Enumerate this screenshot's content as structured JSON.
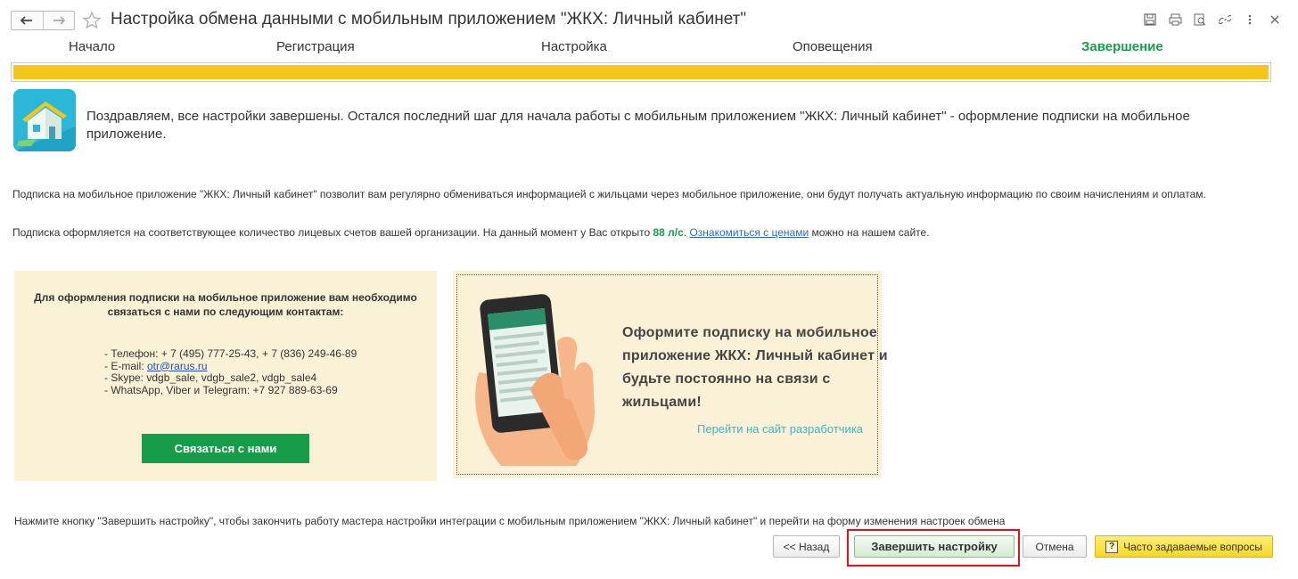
{
  "window": {
    "title": "Настройка обмена данными с мобильным приложением \"ЖКХ: Личный кабинет\""
  },
  "steps": [
    {
      "label": "Начало",
      "active": false
    },
    {
      "label": "Регистрация",
      "active": false
    },
    {
      "label": "Настройка",
      "active": false
    },
    {
      "label": "Оповещения",
      "active": false
    },
    {
      "label": "Завершение",
      "active": true
    }
  ],
  "progress": {
    "value": 1.0,
    "color": "#f5c518"
  },
  "intro": "Поздравляем, все настройки завершены. Остался последний шаг для начала работы с мобильным приложением \"ЖКХ: Личный кабинет\" - оформление подписки на мобильное приложение.",
  "paragraph1": "Подписка на мобильное приложение \"ЖКХ: Личный кабинет\" позволит вам регулярно обмениваться информацией с жильцами через мобильное приложение, они будут получать актуальную информацию по своим начислениям и оплатам.",
  "paragraph2": {
    "before": "Подписка оформляется на соответствующее количество лицевых счетов вашей организации. На данный момент у Вас открыто ",
    "accounts": "88 л/с",
    "after_accounts": ". ",
    "link": "Ознакомиться с ценами",
    "after_link": " можно на нашем сайте."
  },
  "contact": {
    "heading": "Для оформления подписки на мобильное приложение вам необходимо связаться с нами по следующим контактам:",
    "phone": "- Телефон: + 7 (495) 777-25-43, + 7 (836) 249-46-89",
    "email_prefix": "- E-mail: ",
    "email": "otr@rarus.ru",
    "skype": "- Skype: vdgb_sale, vdgb_sale2, vdgb_sale4",
    "messengers": "- WhatsApp, Viber и Telegram: +7 927 889-63-69",
    "button": "Связаться с нами"
  },
  "promo": {
    "text": "Оформите подписку на мобильное приложение ЖКХ: Личный кабинет и будьте постоянно на связи с жильцами!",
    "link": "Перейти на сайт разработчика"
  },
  "footer_note": "Нажмите кнопку \"Завершить настройку\", чтобы закончить работу мастера настройки интеграции с мобильным приложением \"ЖКХ: Личный кабинет\" и перейти на форму изменения настроек обмена",
  "buttons": {
    "back": "<< Назад",
    "finish": "Завершить настройку",
    "cancel": "Отмена",
    "faq": "Часто задаваемые вопросы",
    "faq_glyph": "?"
  },
  "colors": {
    "accent_green": "#169d4a",
    "progress_yellow": "#f5c518",
    "panel_bg": "#fbf1d6",
    "highlight_red": "#e1141b",
    "link_teal": "#3ab5c9"
  }
}
